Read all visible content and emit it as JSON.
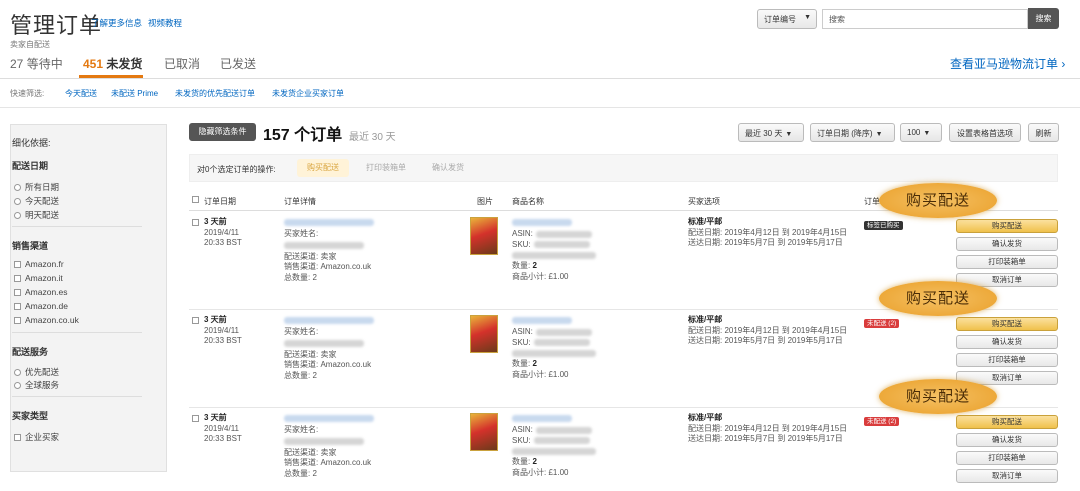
{
  "header": {
    "title": "管理订单",
    "learn_more": "了解更多信息",
    "video_tutorial": "视频教程",
    "seller_fulfilled": "卖家自配送"
  },
  "search": {
    "dropdown_value": "订单编号",
    "placeholder": "搜索",
    "button": "搜索"
  },
  "tabs": [
    {
      "count": "27",
      "label": "等待中"
    },
    {
      "count": "451",
      "label": "未发货"
    },
    {
      "count": "",
      "label": "已取消"
    },
    {
      "count": "",
      "label": "已发送"
    }
  ],
  "amazon_link": "查看亚马逊物流订单 ›",
  "quick_filter": {
    "label": "快速筛选:",
    "items": [
      "今天配送",
      "未配送 Prime",
      "未发货的优先配送订单",
      "未发货企业买家订单"
    ]
  },
  "sidebar": {
    "head": "细化依据:",
    "sections": [
      {
        "title": "配送日期",
        "type": "radio",
        "items": [
          "所有日期",
          "今天配送",
          "明天配送"
        ]
      },
      {
        "title": "销售渠道",
        "type": "check",
        "items": [
          "Amazon.fr",
          "Amazon.it",
          "Amazon.es",
          "Amazon.de",
          "Amazon.co.uk"
        ]
      },
      {
        "title": "配送服务",
        "type": "radio",
        "items": [
          "优先配送",
          "全球服务"
        ]
      },
      {
        "title": "买家类型",
        "type": "check",
        "items": [
          "企业买家"
        ]
      }
    ]
  },
  "toolbar": {
    "hide_filters": "隐藏筛选条件",
    "order_count": "157 个订单",
    "order_range": "最近 30 天",
    "range_select": "最近 30 天",
    "sort_select": "订单日期 (降序)",
    "per_page": "100",
    "settings": "设置表格首选项",
    "refresh": "刷新"
  },
  "bulk": {
    "label": "对0个选定订单的操作:",
    "buy_shipping": "购买配送",
    "print_slip": "打印装箱单",
    "confirm_ship": "确认发货"
  },
  "table_headers": {
    "date": "订单日期",
    "details": "订单详情",
    "image": "图片",
    "product": "商品名称",
    "buyer_options": "买家选项",
    "status": "订单"
  },
  "orders": [
    {
      "age": "3 天前",
      "date": "2019/4/11",
      "time": "20:33 BST",
      "buyer_label": "买家姓名:",
      "channel_label": "配送渠道: 卖家",
      "sales_channel": "销售渠道: Amazon.co.uk",
      "total": "总数量: 2",
      "asin": "ASIN:",
      "sku": "SKU:",
      "qty_label": "数量: ",
      "qty": "2",
      "subtotal": "商品小计: £1.00",
      "ship_type": "标准/平邮",
      "ship_date": "配送日期: 2019年4月12日 到 2019年4月15日",
      "deliver_date": "送达日期: 2019年5月7日 到 2019年5月17日",
      "badge": "标签已购买",
      "badge_type": "dark",
      "actions": [
        "购买配送",
        "确认发货",
        "打印装箱单",
        "取消订单"
      ]
    },
    {
      "age": "3 天前",
      "date": "2019/4/11",
      "time": "20:33 BST",
      "buyer_label": "买家姓名:",
      "channel_label": "配送渠道: 卖家",
      "sales_channel": "销售渠道: Amazon.co.uk",
      "total": "总数量: 2",
      "asin": "ASIN:",
      "sku": "SKU:",
      "qty_label": "数量: ",
      "qty": "2",
      "subtotal": "商品小计: £1.00",
      "ship_type": "标准/平邮",
      "ship_date": "配送日期: 2019年4月12日 到 2019年4月15日",
      "deliver_date": "送达日期: 2019年5月7日 到 2019年5月17日",
      "badge": "未配送 (2)",
      "badge_type": "red",
      "actions": [
        "购买配送",
        "确认发货",
        "打印装箱单",
        "取消订单"
      ]
    },
    {
      "age": "3 天前",
      "date": "2019/4/11",
      "time": "20:33 BST",
      "buyer_label": "买家姓名:",
      "channel_label": "配送渠道: 卖家",
      "sales_channel": "销售渠道: Amazon.co.uk",
      "total": "总数量: 2",
      "asin": "ASIN:",
      "sku": "SKU:",
      "qty_label": "数量: ",
      "qty": "2",
      "subtotal": "商品小计: £1.00",
      "ship_type": "标准/平邮",
      "ship_date": "配送日期: 2019年4月12日 到 2019年4月15日",
      "deliver_date": "送达日期: 2019年5月7日 到 2019年5月17日",
      "badge": "未配送 (2)",
      "badge_type": "red",
      "actions": [
        "购买配送",
        "确认发货",
        "打印装箱单",
        "取消订单"
      ]
    }
  ],
  "callout_text": "购买配送",
  "colors": {
    "accent": "#e47911",
    "link": "#0066c0",
    "callout": "#eda93a",
    "button_yellow": "#f0c14b"
  }
}
